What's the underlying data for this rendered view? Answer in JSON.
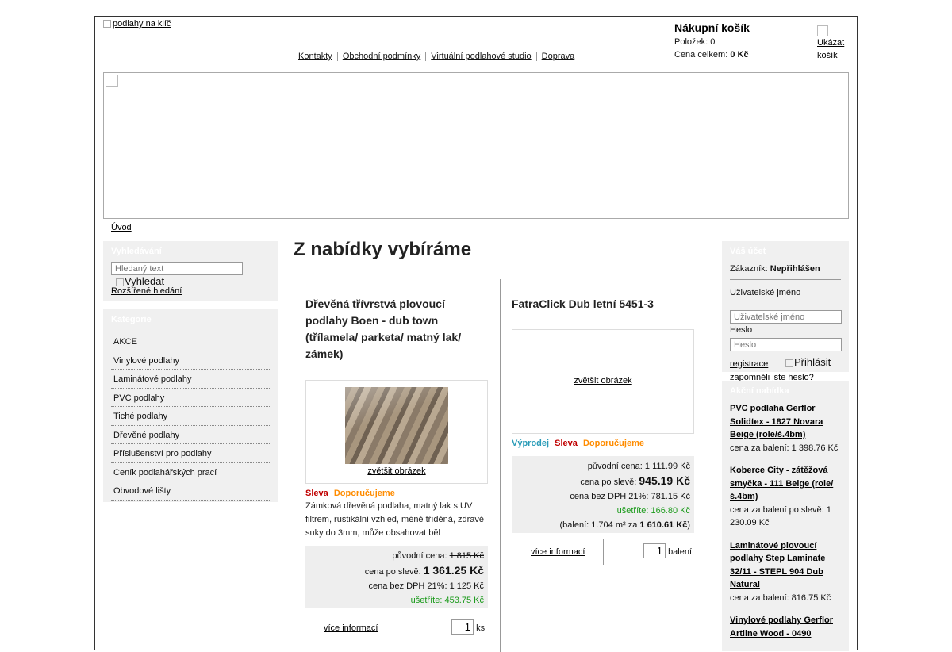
{
  "header": {
    "logo_alt": "podlahy na klíč",
    "nav": [
      "Kontakty",
      "Obchodní podmínky",
      "Virtuální podlahové studio",
      "Doprava"
    ]
  },
  "cart": {
    "title": "Nákupní košík",
    "items_label": "Položek:",
    "items_value": "0",
    "total_label": "Cena celkem:",
    "total_value": "0 Kč",
    "show_alt": "Ukázat košík"
  },
  "breadcrumb": "Úvod",
  "search": {
    "title": "Vyhledávání",
    "placeholder": "Hledaný text",
    "button_alt": "Vyhledat",
    "advanced": "Rozšířené hledání"
  },
  "categories": {
    "title": "Kategorie",
    "items": [
      "AKCE",
      "Vinylové podlahy",
      "Laminátové podlahy",
      "PVC podlahy",
      "Tiché podlahy",
      "Dřevěné podlahy",
      "Příslušenství pro podlahy",
      "Ceník podlahářských prací",
      "Obvodové lišty"
    ]
  },
  "main": {
    "title": "Z nabídky vybíráme",
    "products": [
      {
        "title": "Dřevěná třívrstvá plovoucí podlahy Boen - dub town (třílamela/ parketa/ matný lak/ zámek)",
        "zoom": "zvětšit obrázek",
        "badges": [
          "Sleva",
          "Doporučujeme"
        ],
        "description": "Zámková dřevěná podlaha, matný lak s UV filtrem, rustikální vzhled, méně tříděná, zdravé suky do 3mm, může obsahovat běl",
        "orig_label": "původní cena:",
        "orig_price": "1 815 Kč",
        "sale_label": "cena po slevě:",
        "sale_price": "1 361.25 Kč",
        "net_label": "cena bez DPH 21%:",
        "net_price": "1 125 Kč",
        "save_label": "ušetříte:",
        "save_price": "453.75 Kč",
        "more": "více informací",
        "qty": "1",
        "unit": "ks"
      },
      {
        "title": "FatraClick Dub letní 5451-3",
        "zoom": "zvětšit obrázek",
        "badges": [
          "Výprodej",
          "Sleva",
          "Doporučujeme"
        ],
        "orig_label": "původní cena:",
        "orig_price": "1 111.99 Kč",
        "sale_label": "cena po slevě:",
        "sale_price": "945.19 Kč",
        "net_label": "cena bez DPH 21%:",
        "net_price": "781.15 Kč",
        "save_label": "ušetříte:",
        "save_price": "166.80 Kč",
        "pack_prefix": "(balení: 1.704 m² za ",
        "pack_price": "1 610.61 Kč",
        "pack_suffix": ")",
        "more": "více informací",
        "qty": "1",
        "unit": "balení"
      }
    ]
  },
  "account": {
    "title": "Váš účet",
    "customer_label": "Zákazník:",
    "customer_value": "Nepřihlášen",
    "username_label": "Uživatelské jméno",
    "username_placeholder": "Uživatelské jméno",
    "password_label": "Heslo",
    "password_placeholder": "Heslo",
    "register": "registrace",
    "login_alt": "Přihlásit",
    "forgot": "zapomněli jste heslo?"
  },
  "offers": {
    "title": "Akční nabídka",
    "items": [
      {
        "name": "PVC podlaha Gerflor Solidtex - 1827 Novara Beige (role/š.4bm)",
        "price": "cena za balení: 1 398.76 Kč"
      },
      {
        "name": "Koberce City - zátěžová smyčka - 111 Beige (role/ š.4bm)",
        "price": "cena za balení po slevě: 1 230.09 Kč"
      },
      {
        "name": "Laminátové plovoucí podlahy Step Laminate 32/11 - STEPL 904 Dub Natural",
        "price": "cena za balení: 816.75 Kč"
      },
      {
        "name": "Vinylové podlahy Gerflor Artline Wood - 0490",
        "price": ""
      }
    ]
  }
}
